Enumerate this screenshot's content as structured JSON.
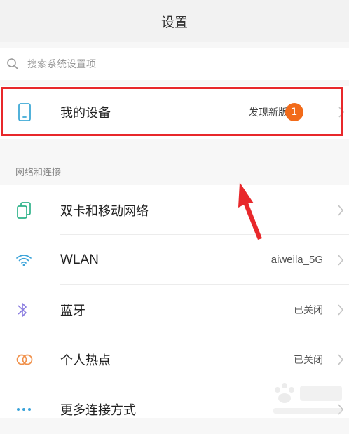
{
  "header": {
    "title": "设置"
  },
  "search": {
    "placeholder": "搜索系统设置项"
  },
  "my_device": {
    "label": "我的设备",
    "status": "发现新版本",
    "badge_count": "1"
  },
  "section": {
    "title": "网络和连接"
  },
  "items": [
    {
      "label": "双卡和移动网络",
      "value": "",
      "icon": "dual-sim-icon"
    },
    {
      "label": "WLAN",
      "value": "aiweila_5G",
      "icon": "wifi-icon"
    },
    {
      "label": "蓝牙",
      "value": "已关闭",
      "icon": "bluetooth-icon"
    },
    {
      "label": "个人热点",
      "value": "已关闭",
      "icon": "hotspot-icon"
    },
    {
      "label": "更多连接方式",
      "value": "",
      "icon": "more-icon"
    }
  ],
  "colors": {
    "highlight": "#e8282b",
    "badge": "#f26b1a",
    "arrow": "#e8282b"
  }
}
